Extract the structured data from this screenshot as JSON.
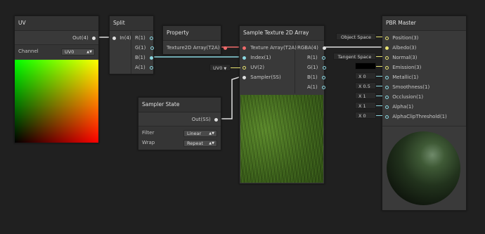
{
  "uv_node": {
    "title": "UV",
    "out_port": "Out(4)",
    "channel_label": "Channel",
    "channel_value": "UV0"
  },
  "split_node": {
    "title": "Split",
    "in_port": "In(4)",
    "outs": [
      "R(1)",
      "G(1)",
      "B(1)",
      "A(1)"
    ]
  },
  "property_node": {
    "title": "Property",
    "out_port": "Texture2D Array(T2A)"
  },
  "sample_node": {
    "title": "Sample Texture 2D Array",
    "inputs": [
      "Texture Array(T2A)",
      "Index(1)",
      "UV(2)",
      "Sampler(SS)"
    ],
    "outputs": [
      "RGBA(4)",
      "R(1)",
      "G(1)",
      "B(1)",
      "A(1)"
    ],
    "uv_field": "UV0"
  },
  "sampler_node": {
    "title": "Sampler State",
    "out_port": "Out(SS)",
    "filter_label": "Filter",
    "filter_value": "Linear",
    "wrap_label": "Wrap",
    "wrap_value": "Repeat"
  },
  "pbr_node": {
    "title": "PBR Master",
    "inputs": [
      "Position(3)",
      "Albedo(3)",
      "Normal(3)",
      "Emission(3)",
      "Metallic(1)",
      "Smoothness(1)",
      "Occlusion(1)",
      "Alpha(1)",
      "AlphaClipThreshold(1)"
    ],
    "position_space": "Object Space",
    "normal_space": "Tangent Space",
    "metallic": "0",
    "smoothness": "0.5",
    "occlusion": "1",
    "alpha": "1",
    "alpha_clip": "0"
  },
  "colors": {
    "background": "#202020",
    "node": "#393939",
    "texture_wire": "#f06a6a",
    "float_wire": "#8ad6e0",
    "vector_wire": "#e0e0e0"
  }
}
